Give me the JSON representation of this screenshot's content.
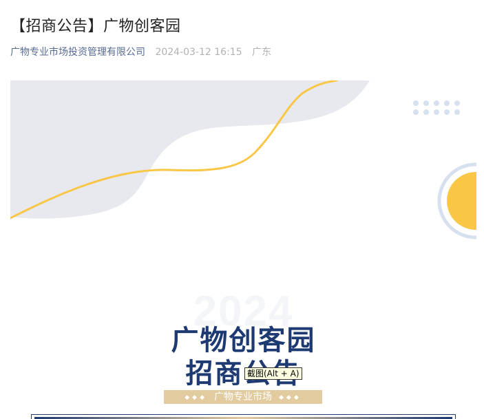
{
  "article": {
    "title": "【招商公告】广物创客园",
    "author": "广物专业市场投资管理有限公司",
    "date": "2024-03-12 16:15",
    "location": "广东"
  },
  "banner": {
    "year": "2024",
    "title_line1": "广物创客园",
    "title_line2": "招商公告",
    "subtitle": "广物专业市场",
    "subtitle_dots": "◆◆◆"
  },
  "tooltip": {
    "text": "截图(Alt + A)"
  },
  "colors": {
    "navy": "#1e3a72",
    "gold": "#f9c646",
    "tan": "#e3cba0",
    "wave_gray": "#e7e9ef",
    "dot_blue": "#d6e0ee"
  }
}
